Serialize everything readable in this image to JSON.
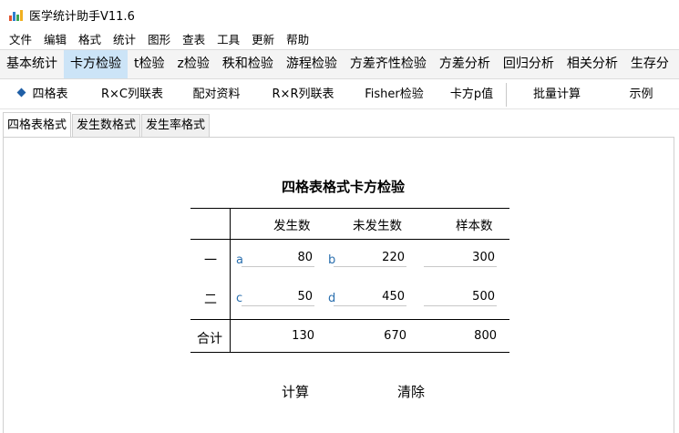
{
  "app": {
    "title": "医学统计助手V11.6",
    "icon": "bar-chart-icon"
  },
  "menu": [
    "文件",
    "编辑",
    "格式",
    "统计",
    "图形",
    "查表",
    "工具",
    "更新",
    "帮助"
  ],
  "main_tabs": [
    "基本统计",
    "卡方检验",
    "t检验",
    "z检验",
    "秩和检验",
    "游程检验",
    "方差齐性检验",
    "方差分析",
    "回归分析",
    "相关分析",
    "生存分"
  ],
  "main_tabs_active": 1,
  "sub_tabs": [
    "四格表",
    "R×C列联表",
    "配对资料",
    "R×R列联表",
    "Fisher检验",
    "卡方p值",
    "批量计算",
    "示例"
  ],
  "format_tabs": [
    "四格表格式",
    "发生数格式",
    "发生率格式"
  ],
  "form": {
    "title": "四格表格式卡方检验",
    "col_headers": [
      "发生数",
      "未发生数",
      "样本数"
    ],
    "rows": [
      {
        "label": "一",
        "letter_a": "a",
        "a": "80",
        "letter_b": "b",
        "b": "220",
        "n": "300"
      },
      {
        "label": "二",
        "letter_a": "c",
        "a": "50",
        "letter_b": "d",
        "b": "450",
        "n": "500"
      }
    ],
    "total": {
      "label": "合计",
      "a": "130",
      "b": "670",
      "n": "800"
    }
  },
  "buttons": {
    "calculate": "计算",
    "clear": "清除"
  },
  "colors": {
    "accent": "#1f5fa6",
    "active_tab": "#cce4f7",
    "letter": "#2a6fae"
  }
}
